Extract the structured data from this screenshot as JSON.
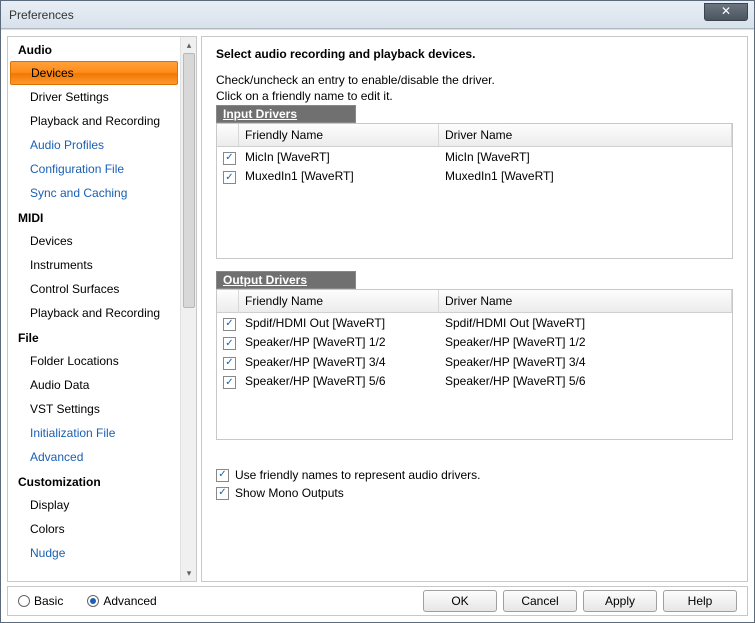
{
  "window": {
    "title": "Preferences"
  },
  "sidebar": {
    "categories": [
      {
        "header": "Audio",
        "items": [
          {
            "label": "Devices",
            "selected": true,
            "link": false
          },
          {
            "label": "Driver Settings",
            "link": false
          },
          {
            "label": "Playback and Recording",
            "link": false
          },
          {
            "label": "Audio Profiles",
            "link": true
          },
          {
            "label": "Configuration File",
            "link": true
          },
          {
            "label": "Sync and Caching",
            "link": true
          }
        ]
      },
      {
        "header": "MIDI",
        "items": [
          {
            "label": "Devices",
            "link": false
          },
          {
            "label": "Instruments",
            "link": false
          },
          {
            "label": "Control Surfaces",
            "link": false
          },
          {
            "label": "Playback and Recording",
            "link": false
          }
        ]
      },
      {
        "header": "File",
        "items": [
          {
            "label": "Folder Locations",
            "link": false
          },
          {
            "label": "Audio Data",
            "link": false
          },
          {
            "label": "VST Settings",
            "link": false
          },
          {
            "label": "Initialization File",
            "link": true
          },
          {
            "label": "Advanced",
            "link": true
          }
        ]
      },
      {
        "header": "Customization",
        "items": [
          {
            "label": "Display",
            "link": false
          },
          {
            "label": "Colors",
            "link": false
          },
          {
            "label": "Nudge",
            "link": true
          }
        ]
      }
    ]
  },
  "pane": {
    "title": "Select audio recording and playback devices.",
    "line1": "Check/uncheck an entry to enable/disable the driver.",
    "line2": "Click on a friendly name to edit it.",
    "input_header": "Input Drivers",
    "output_header": "Output Drivers",
    "col_friendly": "Friendly Name",
    "col_driver": "Driver Name",
    "input_rows": [
      {
        "checked": true,
        "friendly": "MicIn [WaveRT]",
        "driver": "MicIn [WaveRT]"
      },
      {
        "checked": true,
        "friendly": "MuxedIn1 [WaveRT]",
        "driver": "MuxedIn1 [WaveRT]"
      }
    ],
    "output_rows": [
      {
        "checked": true,
        "friendly": "Spdif/HDMI Out [WaveRT]",
        "driver": "Spdif/HDMI Out [WaveRT]"
      },
      {
        "checked": true,
        "friendly": "Speaker/HP [WaveRT] 1/2",
        "driver": "Speaker/HP [WaveRT] 1/2"
      },
      {
        "checked": true,
        "friendly": "Speaker/HP [WaveRT] 3/4",
        "driver": "Speaker/HP [WaveRT] 3/4"
      },
      {
        "checked": true,
        "friendly": "Speaker/HP [WaveRT] 5/6",
        "driver": "Speaker/HP [WaveRT] 5/6"
      }
    ],
    "opt_friendly": {
      "checked": true,
      "label": "Use friendly names to represent audio drivers."
    },
    "opt_mono": {
      "checked": true,
      "label": "Show Mono Outputs"
    }
  },
  "footer": {
    "basic": "Basic",
    "advanced": "Advanced",
    "mode": "advanced",
    "ok": "OK",
    "cancel": "Cancel",
    "apply": "Apply",
    "help": "Help"
  }
}
